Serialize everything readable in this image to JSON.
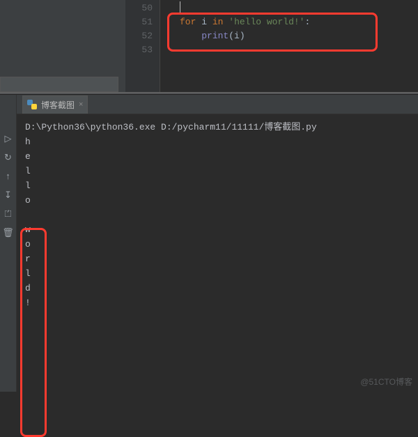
{
  "editor": {
    "lines": [
      {
        "num": "50",
        "html": ""
      },
      {
        "num": "51",
        "html": "<span class='kw'>for</span> <span class='id'>i</span> <span class='kw'>in</span> <span class='str'>'hello world!'</span><span class='paren'>:</span>"
      },
      {
        "num": "52",
        "html": "    <span class='builtin'>print</span><span class='paren'>(</span><span class='id'>i</span><span class='paren'>)</span>"
      },
      {
        "num": "53",
        "html": ""
      }
    ]
  },
  "run": {
    "tab_label": "博客截图",
    "close_glyph": "×",
    "command": "D:\\Python36\\python36.exe D:/pycharm11/11111/博客截图.py",
    "output_lines": [
      "h",
      "e",
      "l",
      "l",
      "o",
      " ",
      "w",
      "o",
      "r",
      "l",
      "d",
      "!"
    ]
  },
  "side_icons": {
    "play": "▷",
    "restart": "↻",
    "stop": "↑",
    "down": "↧",
    "exit": "⏍",
    "trash": "🗑"
  },
  "watermark": "@51CTO博客"
}
